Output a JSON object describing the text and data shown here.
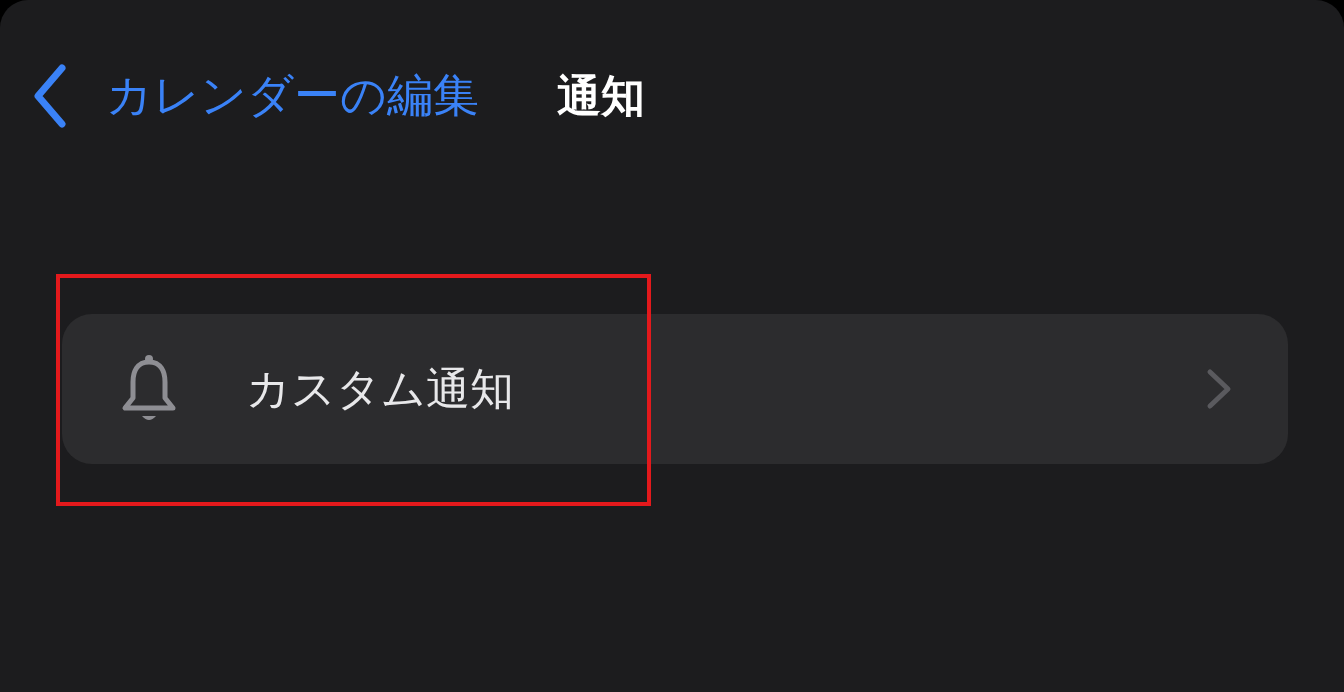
{
  "nav": {
    "back_label": "カレンダーの編集",
    "title": "通知"
  },
  "items": [
    {
      "label": "カスタム通知",
      "highlighted": true
    }
  ]
}
